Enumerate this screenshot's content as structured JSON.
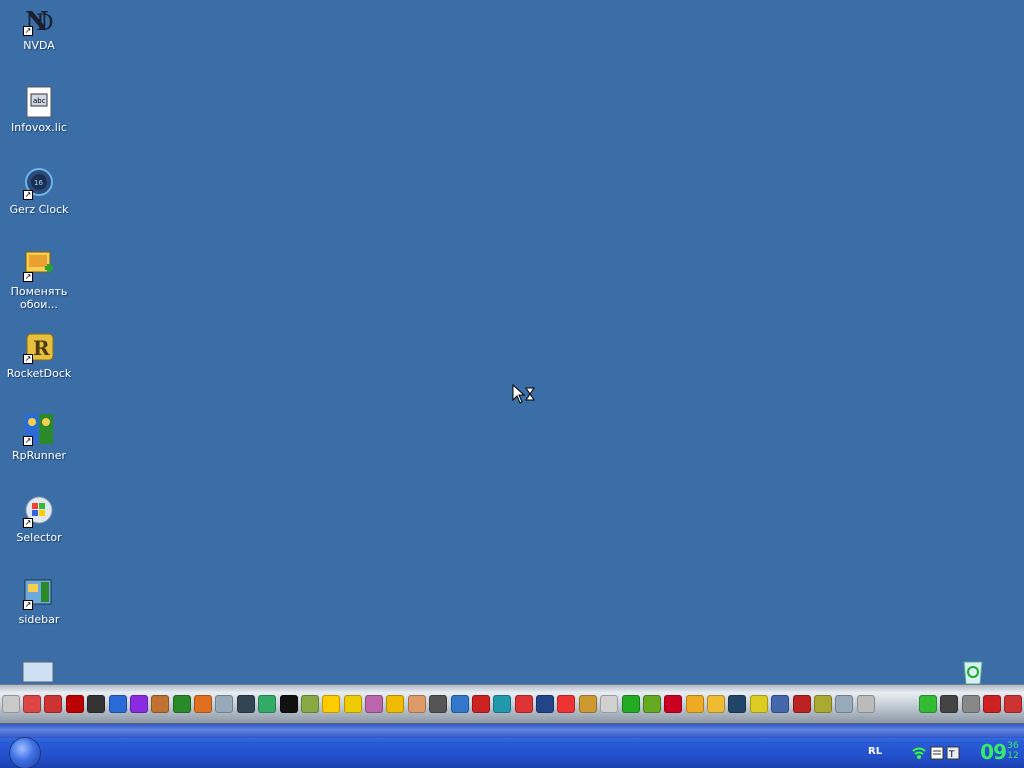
{
  "desktop": {
    "icons": [
      {
        "label": "NVDA",
        "icon": "nvda-icon"
      },
      {
        "label": "Infovox.lic",
        "icon": "file-icon"
      },
      {
        "label": "Gerz Clock",
        "icon": "clock-icon"
      },
      {
        "label": "Поменять обои...",
        "icon": "wallpaper-icon"
      },
      {
        "label": "RocketDock",
        "icon": "rocketdock-icon"
      },
      {
        "label": "RpRunner",
        "icon": "rprunner-icon"
      },
      {
        "label": "Selector",
        "icon": "selector-icon"
      },
      {
        "label": "sidebar",
        "icon": "sidebar-icon"
      }
    ],
    "background_color": "#3b6ea6"
  },
  "dock": {
    "item_colors": [
      "#c9c9c9",
      "#d44",
      "#c33",
      "#b00",
      "#333",
      "#2a6bd8",
      "#8a2be2",
      "#c07030",
      "#2a8a2a",
      "#e07020",
      "#9ab",
      "#345",
      "#3a6",
      "#111",
      "#8a4",
      "#fc0",
      "#ec0",
      "#b6a",
      "#eb0",
      "#d96",
      "#555",
      "#37c",
      "#c22",
      "#29a",
      "#d33",
      "#248",
      "#e33",
      "#c93",
      "#d1d1d1",
      "#2a2",
      "#6a2",
      "#c02",
      "#ea2",
      "#eb3",
      "#246",
      "#dc2",
      "#46a",
      "#b22",
      "#aa3",
      "#9ab",
      "#bbb"
    ],
    "right_item_colors": [
      "#3b3",
      "#444",
      "#888",
      "#c22",
      "#c33"
    ]
  },
  "taskbar": {
    "language": "RL",
    "clock_hours": "09",
    "clock_minutes": "36",
    "clock_seconds": "12"
  }
}
